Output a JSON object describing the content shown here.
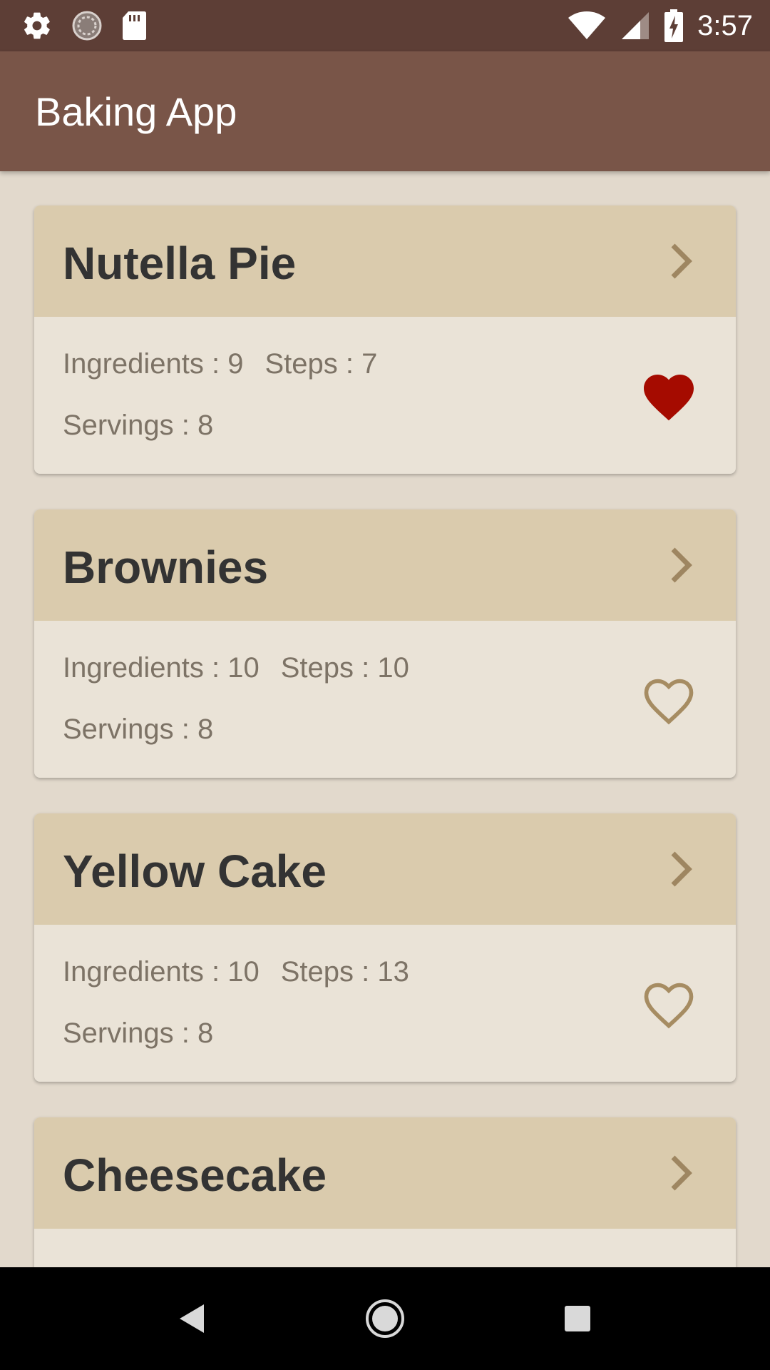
{
  "status_bar": {
    "time": "3:57",
    "left_icons": [
      "gear-icon",
      "sync-icon",
      "sd-card-icon"
    ],
    "right_icons": [
      "wifi-icon",
      "cell-signal-icon",
      "battery-charging-icon"
    ]
  },
  "app_bar": {
    "title": "Baking App"
  },
  "recipes": [
    {
      "name": "Nutella Pie",
      "ingredients_label": "Ingredients : 9",
      "steps_label": "Steps : 7",
      "servings_label": "Servings : 8",
      "favorite": true
    },
    {
      "name": "Brownies",
      "ingredients_label": "Ingredients : 10",
      "steps_label": "Steps : 10",
      "servings_label": "Servings : 8",
      "favorite": false
    },
    {
      "name": "Yellow Cake",
      "ingredients_label": "Ingredients : 10",
      "steps_label": "Steps : 13",
      "servings_label": "Servings : 8",
      "favorite": false
    },
    {
      "name": "Cheesecake",
      "ingredients_label": "",
      "steps_label": "",
      "servings_label": "",
      "favorite": false
    }
  ],
  "colors": {
    "status_bar": "#5d3e36",
    "app_bar": "#795548",
    "card_header": "#dacbad",
    "card_body": "#eae3d7",
    "favorite_on": "#a50b00",
    "favorite_off": "#a68c62",
    "chevron": "#9e8661"
  },
  "nav_bar": {
    "buttons": [
      "back-icon",
      "home-icon",
      "recents-icon"
    ]
  }
}
